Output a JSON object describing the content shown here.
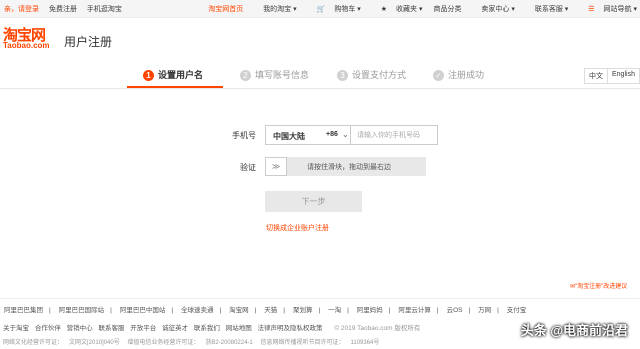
{
  "topbar": {
    "greeting": "亲，请登录",
    "register": "免费注册",
    "mobile": "手机逛淘宝",
    "right_items": [
      "淘宝网首页",
      "我的淘宝",
      "购物车",
      "收藏夹",
      "商品分类",
      "卖家中心",
      "联系客服",
      "网站导航"
    ]
  },
  "header": {
    "logo_cn": "淘宝网",
    "logo_en": "Taobao.com",
    "title": "用户注册"
  },
  "steps": [
    {
      "num": "1",
      "label": "设置用户名"
    },
    {
      "num": "2",
      "label": "填写账号信息"
    },
    {
      "num": "3",
      "label": "设置支付方式"
    },
    {
      "num": "✓",
      "label": "注册成功"
    }
  ],
  "lang": {
    "zh": "中文",
    "en": "English"
  },
  "form": {
    "phone_label": "手机号",
    "country": "中国大陆",
    "country_code": "+86",
    "phone_placeholder": "请输入你的手机号码",
    "verify_label": "验证",
    "slider_handle": "≫",
    "slider_hint": "请按住滑块，拖动到最右边",
    "next_button": "下一步",
    "corp_link": "切换成企业账户注册"
  },
  "feedback": "\"淘宝注册\"改进建议",
  "footer": {
    "links": [
      "阿里巴巴集团",
      "阿里巴巴国际站",
      "阿里巴巴中国站",
      "全球速卖通",
      "淘宝网",
      "天猫",
      "聚划算",
      "一淘",
      "阿里妈妈",
      "阿里云计算",
      "云OS",
      "万网",
      "支付宝"
    ],
    "row2": [
      "关于淘宝",
      "合作伙伴",
      "营销中心",
      "联系客服",
      "开放平台",
      "诚征英才",
      "联系我们",
      "网站地图",
      "法律声明及隐私权政策",
      "© 2019 Taobao.com 版权所有"
    ],
    "row3": [
      "网络文化经营许可证：",
      "文网文[2010]040号",
      "增值电信业务经营许可证：",
      "浙B2-20080224-1",
      "信息网络传播视听节目许可证：",
      "1109364号"
    ]
  },
  "watermark": "头条 @电商前沿君"
}
